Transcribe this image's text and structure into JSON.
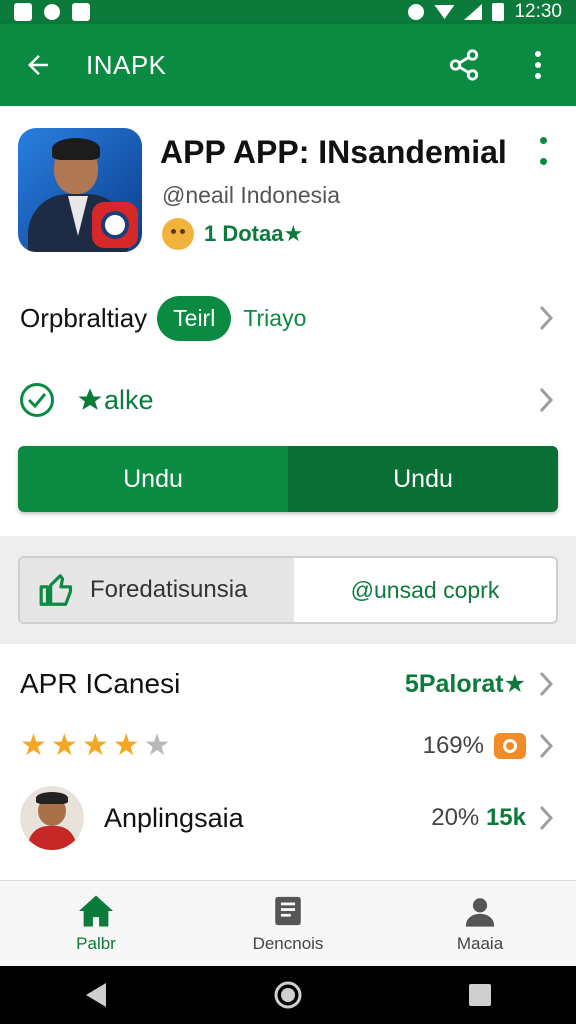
{
  "status_bar": {
    "time": "12:30"
  },
  "app_bar": {
    "title": "INAPK",
    "back_icon": "arrow-back-icon",
    "share_icon": "share-icon",
    "menu_icon": "more-vert-icon"
  },
  "app": {
    "title": "APP APP: INsandemial",
    "developer": "@neail Indonesia",
    "rating_text": "1 Dotaa★"
  },
  "tag_row": {
    "label": "Orpbraltiay",
    "pill": "Teirl",
    "after": "Triayo"
  },
  "check_row": {
    "label": "alke"
  },
  "install": {
    "left": "Undu",
    "right": "Undu"
  },
  "segment": {
    "left": "Foredatisunsia",
    "right": "@unsad coprk"
  },
  "list": {
    "header": {
      "name": "APR ICanesi",
      "value": "5Palorat★"
    },
    "rating": {
      "stars": 4,
      "max": 5,
      "value": "169%"
    },
    "user": {
      "name": "Anplingsaia",
      "value_a": "20%",
      "value_b": "15k"
    }
  },
  "bottom_nav": [
    {
      "label": "Palbr",
      "icon": "home-icon",
      "active": true
    },
    {
      "label": "Dencnois",
      "icon": "news-icon",
      "active": false
    },
    {
      "label": "Maaia",
      "icon": "person-icon",
      "active": false
    }
  ],
  "colors": {
    "primary": "#0b8a42",
    "primary_dark": "#0a6f34",
    "accent_star": "#f5a623"
  }
}
